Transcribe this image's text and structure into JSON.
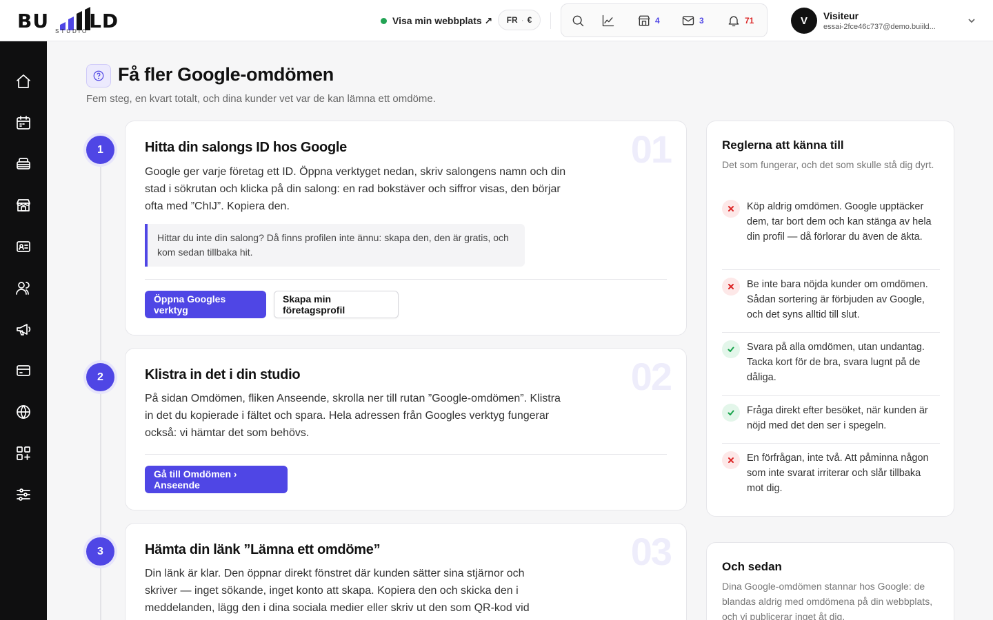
{
  "header": {
    "logo_text": "BUILD",
    "logo_sub": "STUDIO",
    "site_link_label": "Visa min webbplats ↗",
    "lang": "FR",
    "currency": "€",
    "counts": {
      "shop": "4",
      "mail": "3",
      "notifications": "71"
    },
    "user": {
      "initial": "V",
      "name": "Visiteur",
      "email": "essai-2fce46c737@demo.buiild..."
    }
  },
  "sidebar": {
    "items": [
      "home-icon",
      "calendar-icon",
      "services-icon",
      "storefront-icon",
      "contact-card-icon",
      "clients-icon",
      "megaphone-icon",
      "payment-card-icon",
      "globe-icon",
      "apps-icon",
      "settings-sliders-icon"
    ]
  },
  "page": {
    "title": "Få fler Google-omdömen",
    "subtitle": "Fem steg, en kvart totalt, och dina kunder vet var de kan lämna ett omdöme."
  },
  "steps": [
    {
      "number": "1",
      "big_number": "01",
      "title": "Hitta din salongs ID hos Google",
      "body": "Google ger varje företag ett ID. Öppna verktyget nedan, skriv salongens namn och din stad i sökrutan och klicka på din salong: en rad bokstäver och siffror visas, den börjar ofta med ”ChIJ”. Kopiera den.",
      "callout": "Hittar du inte din salong? Då finns profilen inte ännu: skapa den, den är gratis, och kom sedan tillbaka hit.",
      "primary_button": "Öppna Googles verktyg",
      "secondary_button": "Skapa min företagsprofil"
    },
    {
      "number": "2",
      "big_number": "02",
      "title": "Klistra in det i din studio",
      "body": "På sidan Omdömen, fliken Anseende, skrolla ner till rutan ”Google-omdömen”. Klistra in det du kopierade i fältet och spara. Hela adressen från Googles verktyg fungerar också: vi hämtar det som behövs.",
      "primary_button": "Gå till Omdömen › Anseende"
    },
    {
      "number": "3",
      "big_number": "03",
      "title": "Hämta din länk ”Lämna ett omdöme”",
      "body": "Din länk är klar. Den öppnar direkt fönstret där kunden sätter sina stjärnor och skriver — inget sökande, inget konto att skapa. Kopiera den och skicka den i meddelanden, lägg den i dina sociala medier eller skriv ut den som QR-kod vid"
    }
  ],
  "rules_panel": {
    "title": "Reglerna att känna till",
    "subtitle": "Det som fungerar, och det som skulle stå dig dyrt.",
    "rules": [
      {
        "type": "bad",
        "text": "Köp aldrig omdömen. Google upptäcker dem, tar bort dem och kan stänga av hela din profil — då förlorar du även de äkta."
      },
      {
        "type": "bad",
        "text": "Be inte bara nöjda kunder om omdömen. Sådan sortering är förbjuden av Google, och det syns alltid till slut."
      },
      {
        "type": "good",
        "text": "Svara på alla omdömen, utan undantag. Tacka kort för de bra, svara lugnt på de dåliga."
      },
      {
        "type": "good",
        "text": "Fråga direkt efter besöket, när kunden är nöjd med det den ser i spegeln."
      },
      {
        "type": "bad",
        "text": "En förfrågan, inte två. Att påminna någon som inte svarat irriterar och slår tillbaka mot dig."
      }
    ]
  },
  "next_panel": {
    "title": "Och sedan",
    "subtitle": "Dina Google-omdömen stannar hos Google: de blandas aldrig med omdömena på din webbplats, och vi publicerar inget åt dig."
  },
  "colors": {
    "accent": "#4f46e5",
    "bad": "#dc2626",
    "good": "#16a34a",
    "sidebar": "#0f0f10"
  }
}
